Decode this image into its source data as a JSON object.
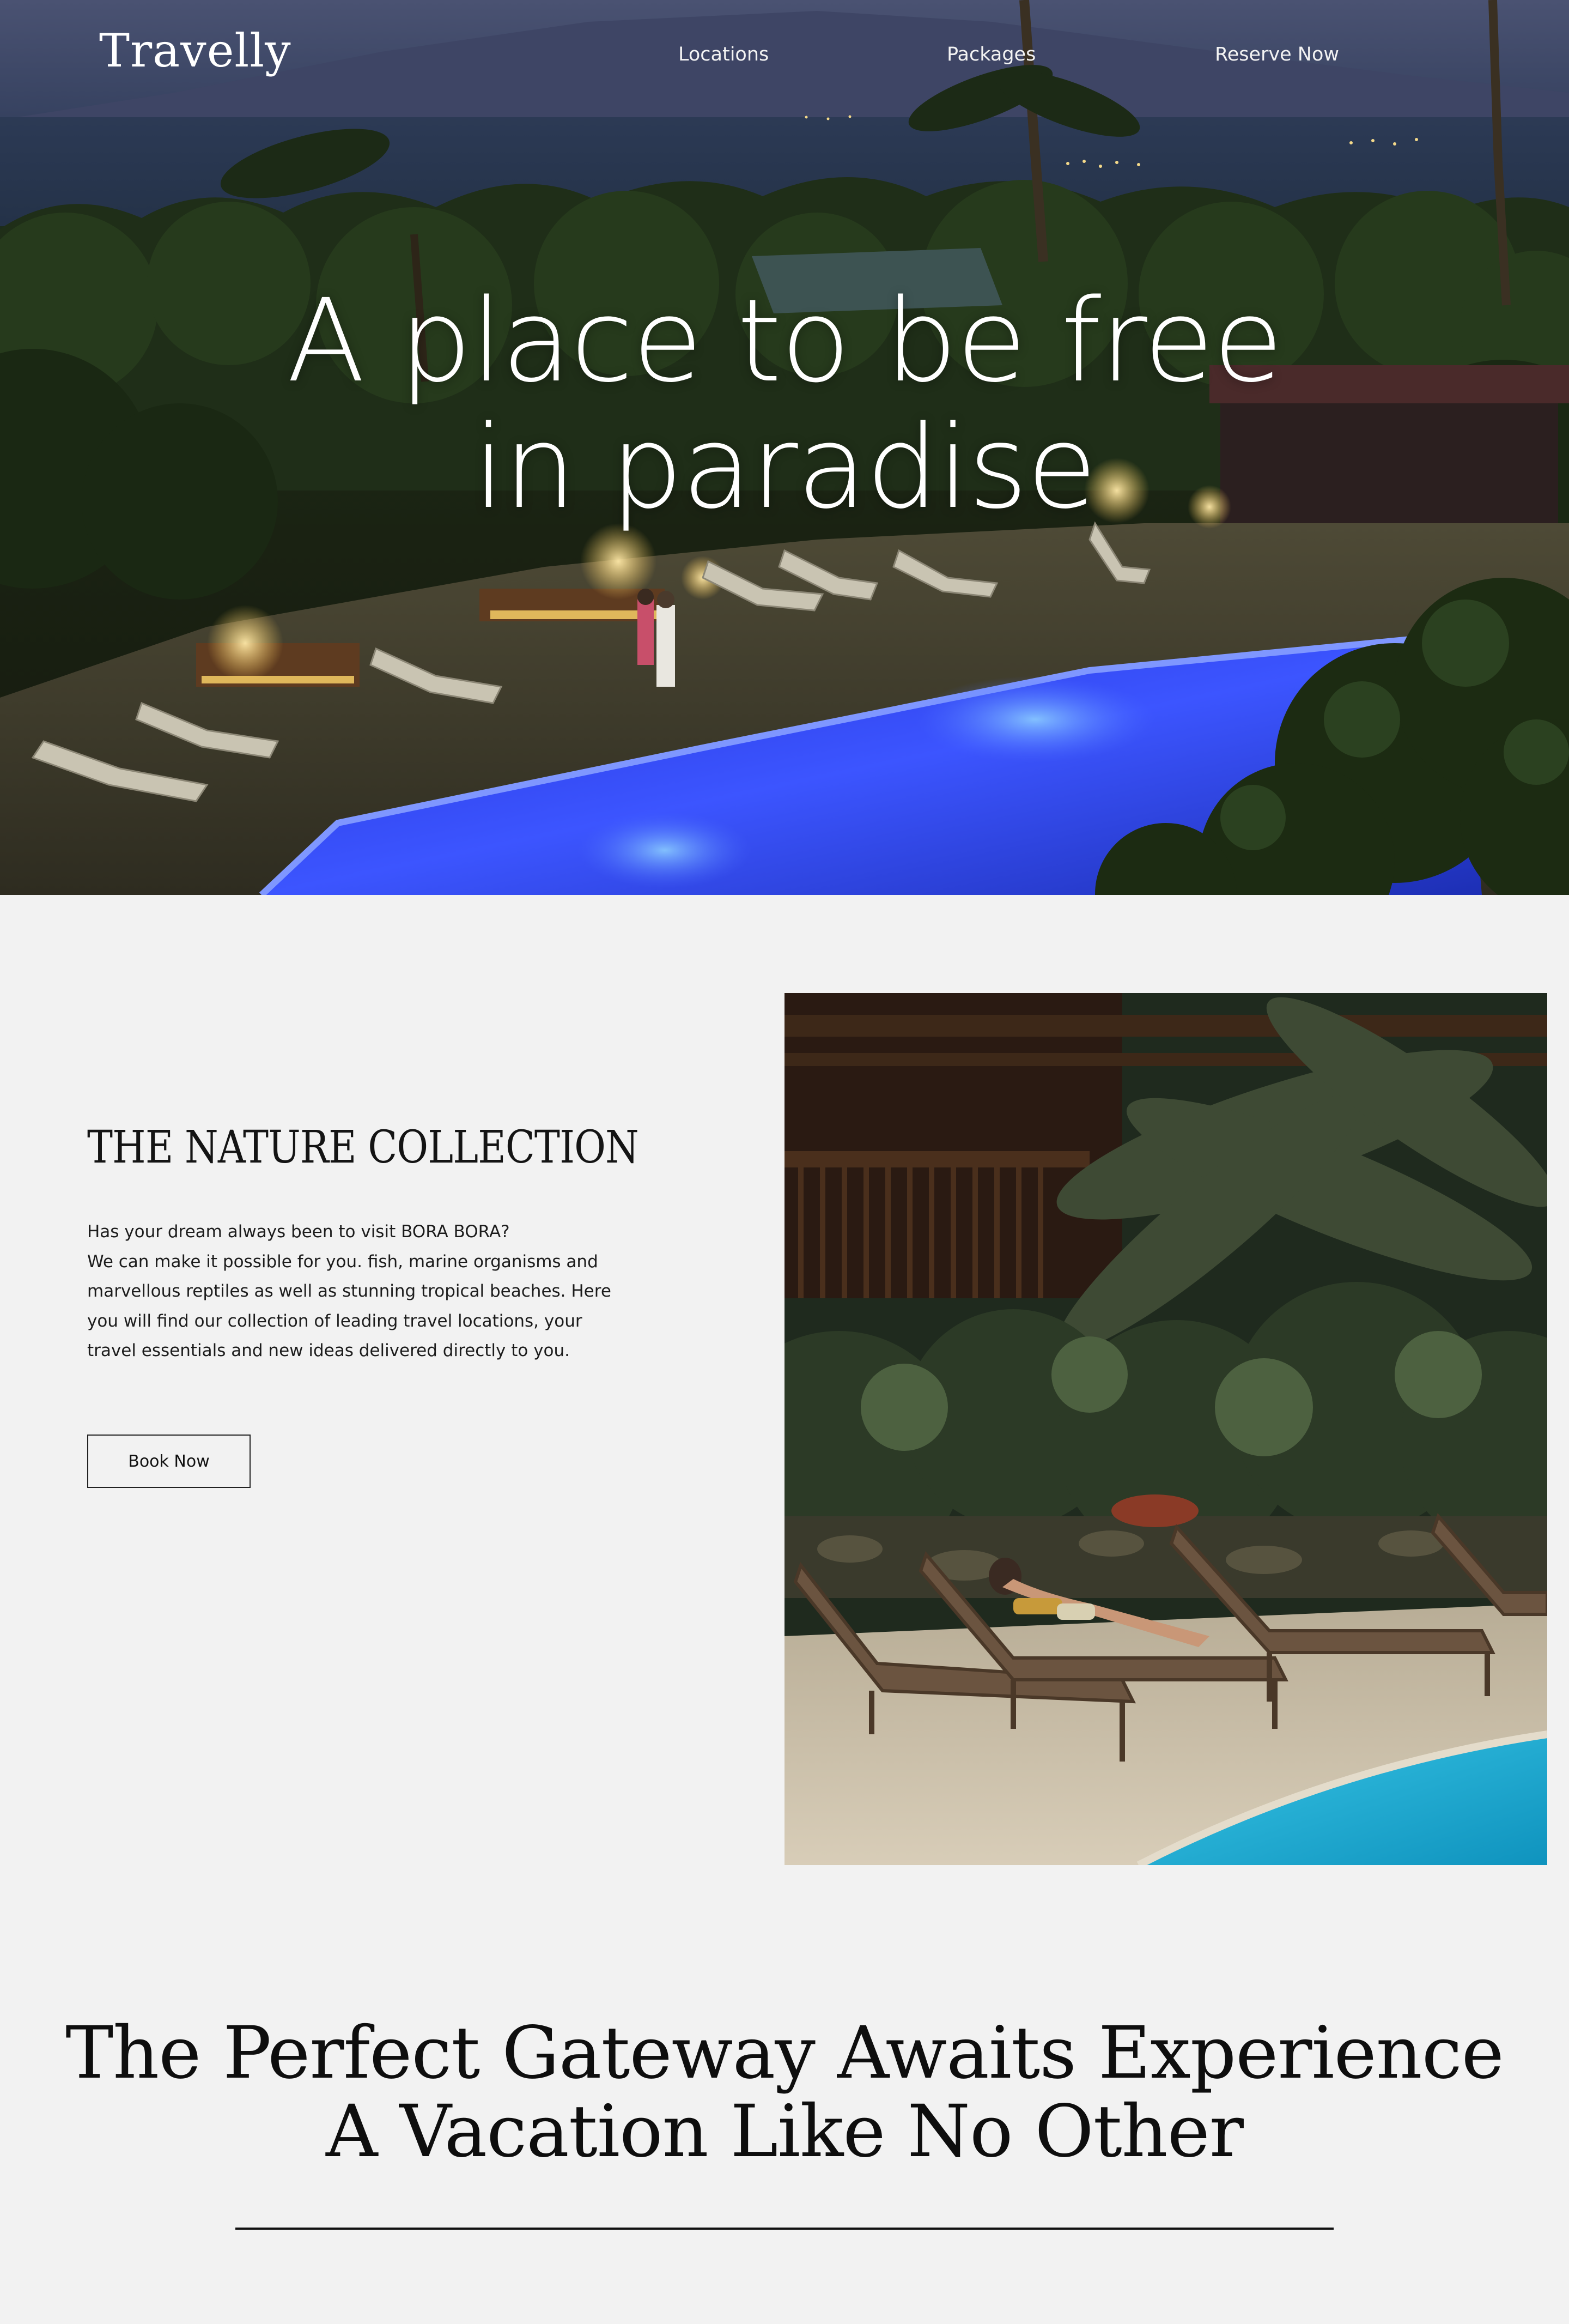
{
  "header": {
    "logo": "Travelly",
    "nav": [
      {
        "label": "Locations"
      },
      {
        "label": "Packages"
      },
      {
        "label": "Reserve Now"
      }
    ]
  },
  "hero": {
    "title_line1": "A place to be free",
    "title_line2": "in paradise",
    "image": "resort-pool-at-night-photo"
  },
  "collection": {
    "title": "THE NATURE COLLECTION",
    "body_lines": [
      "Has your dream always been to visit BORA BORA?",
      "We can make it possible for you. fish, marine organisms and",
      "marvellous reptiles as well as stunning tropical beaches. Here",
      "you will find our collection of leading travel locations, your",
      "travel essentials and new ideas delivered directly to you."
    ],
    "button_label": "Book Now",
    "image": "woman-on-sun-lounger-by-pool-photo"
  },
  "gateway": {
    "title_line1": "The Perfect Gateway Awaits Experience",
    "title_line2": "A Vacation Like No Other"
  },
  "colors": {
    "page_background": "#f2f2f2",
    "text": "#111111",
    "pool_blue": "#3a4cf0",
    "pool_turquoise": "#1fb3d6"
  }
}
